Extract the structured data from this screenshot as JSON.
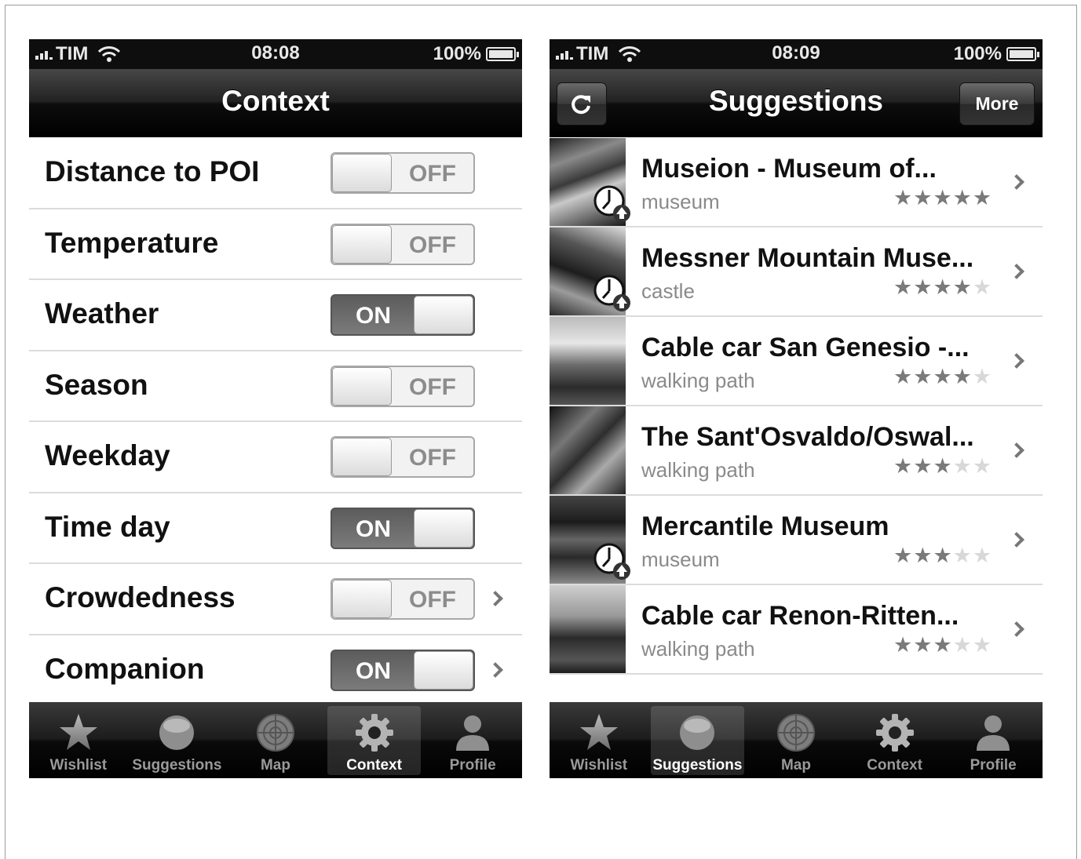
{
  "left_screen": {
    "status": {
      "carrier": "TIM",
      "time": "08:08",
      "battery": "100%"
    },
    "nav_title": "Context",
    "rows": [
      {
        "label": "Distance to POI",
        "state": "OFF",
        "chevron": false
      },
      {
        "label": "Temperature",
        "state": "OFF",
        "chevron": false
      },
      {
        "label": "Weather",
        "state": "ON",
        "chevron": false
      },
      {
        "label": "Season",
        "state": "OFF",
        "chevron": false
      },
      {
        "label": "Weekday",
        "state": "OFF",
        "chevron": false
      },
      {
        "label": "Time day",
        "state": "ON",
        "chevron": false
      },
      {
        "label": "Crowdedness",
        "state": "OFF",
        "chevron": true
      },
      {
        "label": "Companion",
        "state": "ON",
        "chevron": true
      }
    ],
    "tabs": [
      {
        "label": "Wishlist",
        "icon": "star-icon",
        "active": false
      },
      {
        "label": "Suggestions",
        "icon": "circle-icon",
        "active": false
      },
      {
        "label": "Map",
        "icon": "radar-icon",
        "active": false
      },
      {
        "label": "Context",
        "icon": "gear-icon",
        "active": true
      },
      {
        "label": "Profile",
        "icon": "person-icon",
        "active": false
      }
    ]
  },
  "right_screen": {
    "status": {
      "carrier": "TIM",
      "time": "08:09",
      "battery": "100%"
    },
    "nav_title": "Suggestions",
    "refresh_icon": "refresh-icon",
    "more_label": "More",
    "items": [
      {
        "title": "Museion - Museum of...",
        "category": "museum",
        "rating": 5,
        "badge": true
      },
      {
        "title": "Messner Mountain Muse...",
        "category": "castle",
        "rating": 4,
        "badge": true
      },
      {
        "title": "Cable car San Genesio -...",
        "category": "walking path",
        "rating": 4,
        "badge": false
      },
      {
        "title": "The Sant'Osvaldo/Oswal...",
        "category": "walking path",
        "rating": 3,
        "badge": false
      },
      {
        "title": "Mercantile Museum",
        "category": "museum",
        "rating": 3,
        "badge": true
      },
      {
        "title": "Cable car Renon-Ritten...",
        "category": "walking path",
        "rating": 3,
        "badge": false
      }
    ],
    "tabs": [
      {
        "label": "Wishlist",
        "icon": "star-icon",
        "active": false
      },
      {
        "label": "Suggestions",
        "icon": "circle-icon",
        "active": true
      },
      {
        "label": "Map",
        "icon": "radar-icon",
        "active": false
      },
      {
        "label": "Context",
        "icon": "gear-icon",
        "active": false
      },
      {
        "label": "Profile",
        "icon": "person-icon",
        "active": false
      }
    ]
  }
}
